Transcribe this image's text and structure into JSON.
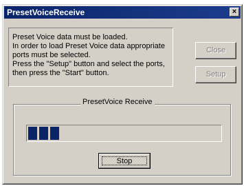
{
  "window": {
    "title": "PresetVoiceReceive",
    "close_glyph": "×"
  },
  "message": {
    "lines": [
      "Preset Voice data must be loaded.",
      "In order to load Preset Voice data appropriate",
      "ports must be selected.",
      "Press the \"Setup\" button and select the ports,",
      "then press the \"Start\" button."
    ]
  },
  "buttons": {
    "close_label": "Close",
    "setup_label": "Setup",
    "stop_label": "Stop"
  },
  "group": {
    "legend": "PresetVoice Receive"
  },
  "progress": {
    "filled_blocks": 3,
    "color": "#0a246a"
  }
}
